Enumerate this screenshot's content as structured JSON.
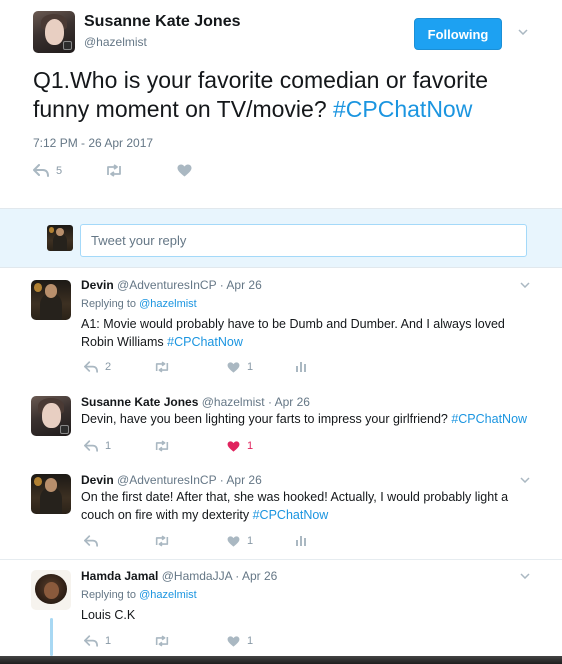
{
  "main_tweet": {
    "author_name": "Susanne Kate Jones",
    "author_handle": "@hazelmist",
    "follow_label": "Following",
    "text_prefix": "Q1.Who is your favorite comedian or favorite funny moment on TV/movie? ",
    "hashtag": "#CPChatNow",
    "timestamp": "7:12 PM - 26 Apr 2017",
    "reply_count": "5"
  },
  "reply_box": {
    "placeholder": "Tweet your reply"
  },
  "replies": [
    {
      "name": "Devin",
      "handle": "@AdventuresInCP",
      "date": "· Apr 26",
      "replying_label": "Replying to",
      "replying_handle": "@hazelmist",
      "text_line1": "A1: Movie would probably have to be Dumb and Dumber. And I always loved",
      "text_line2": "Robin Williams ",
      "hashtag": "#CPChatNow",
      "reply_count": "2",
      "like_count": "1"
    },
    {
      "name": "Susanne Kate Jones",
      "handle": "@hazelmist",
      "date": "· Apr 26",
      "text": "Devin, have you been lighting your farts to impress your girlfriend? ",
      "hashtag": "#CPChatNow",
      "reply_count": "1",
      "like_count": "1"
    },
    {
      "name": "Devin",
      "handle": "@AdventuresInCP",
      "date": "· Apr 26",
      "text_line1": "On the first date! After that, she was hooked! Actually, I would probably light a",
      "text_line2": "couch on fire with my dexterity ",
      "hashtag": "#CPChatNow",
      "like_count": "1"
    },
    {
      "name": "Hamda Jamal",
      "handle": "@HamdaJJA",
      "date": "· Apr 26",
      "replying_label": "Replying to",
      "replying_handle": "@hazelmist",
      "text": "Louis C.K",
      "reply_count": "1",
      "like_count": "1"
    }
  ],
  "colors": {
    "accent": "#1da1f2",
    "link": "#1b95e0",
    "like_active": "#e0245e",
    "thread_line": "#a8d8f3",
    "reply_box_bg": "#e8f5fd"
  },
  "icons": {
    "reply": "reply-arrow-icon",
    "retweet": "retweet-icon",
    "like": "heart-icon",
    "analytics": "bar-chart-icon",
    "more": "chevron-down-icon"
  }
}
